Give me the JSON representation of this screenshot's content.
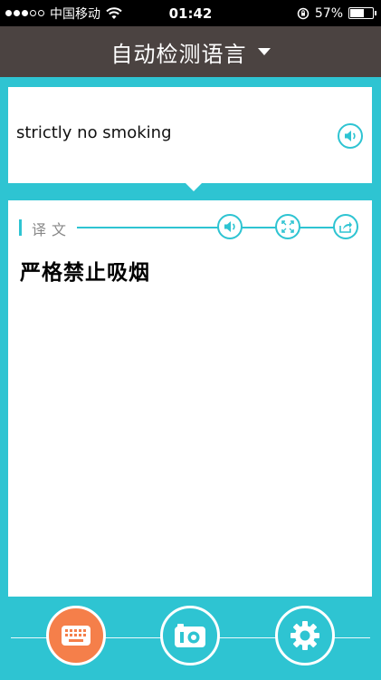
{
  "status_bar": {
    "carrier": "中国移动",
    "time": "01:42",
    "battery": "57%",
    "battery_level": 0.57
  },
  "header": {
    "title": "自动检测语言"
  },
  "source": {
    "text": "strictly no smoking"
  },
  "result": {
    "label": "译文",
    "text": "严格禁止吸烟"
  },
  "watermark": "",
  "colors": {
    "accent": "#2ec4d2",
    "header_bg": "#4b4341",
    "keyboard_button": "#f57f4a"
  },
  "icons": {
    "source_speaker": "speaker-icon",
    "result_speaker": "speaker-icon",
    "fullscreen": "fullscreen-icon",
    "share": "share-icon",
    "keyboard": "keyboard-icon",
    "camera": "camera-icon",
    "settings": "gear-icon"
  }
}
